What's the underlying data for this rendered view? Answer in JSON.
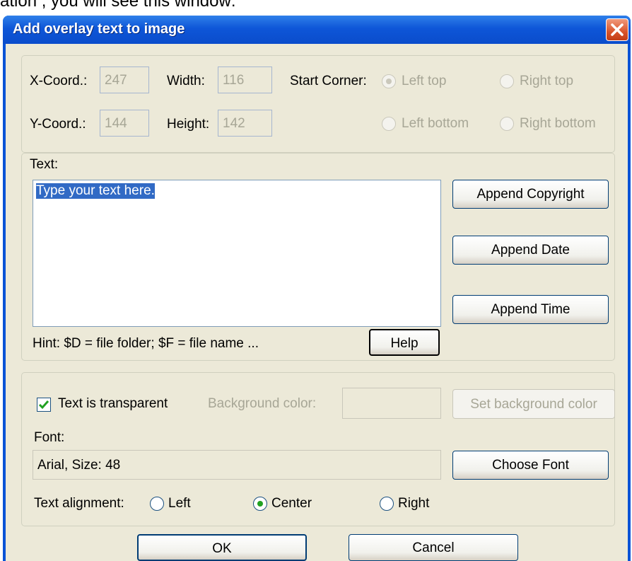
{
  "caption": "ation , you will see this window:",
  "window": {
    "title": "Add overlay text to image"
  },
  "coords": {
    "x_label": "X-Coord.:",
    "x_value": "247",
    "y_label": "Y-Coord.:",
    "y_value": "144",
    "width_label": "Width:",
    "width_value": "116",
    "height_label": "Height:",
    "height_value": "142",
    "start_corner_label": "Start Corner:",
    "corners": [
      "Left top",
      "Right top",
      "Left bottom",
      "Right bottom"
    ],
    "selected_corner": "Left top"
  },
  "text_section": {
    "label": "Text:",
    "value": "Type your text here.",
    "hint": "Hint: $D = file folder; $F = file name ...",
    "help_button": "Help",
    "append_copyright": "Append Copyright",
    "append_date": "Append Date",
    "append_time": "Append Time"
  },
  "style_section": {
    "transparent_label": "Text is transparent",
    "transparent_checked": true,
    "bg_color_label": "Background color:",
    "set_bg_button": "Set background color",
    "font_label": "Font:",
    "font_value": "Arial, Size: 48",
    "choose_font_button": "Choose Font",
    "alignment_label": "Text alignment:",
    "alignments": [
      "Left",
      "Center",
      "Right"
    ],
    "selected_alignment": "Center"
  },
  "footer": {
    "ok": "OK",
    "cancel": "Cancel"
  },
  "colors": {
    "titlebar": "#0a53d6",
    "dialog_bg": "#ece9d8",
    "selection": "#316ac5",
    "radio_dot": "#21a121"
  }
}
